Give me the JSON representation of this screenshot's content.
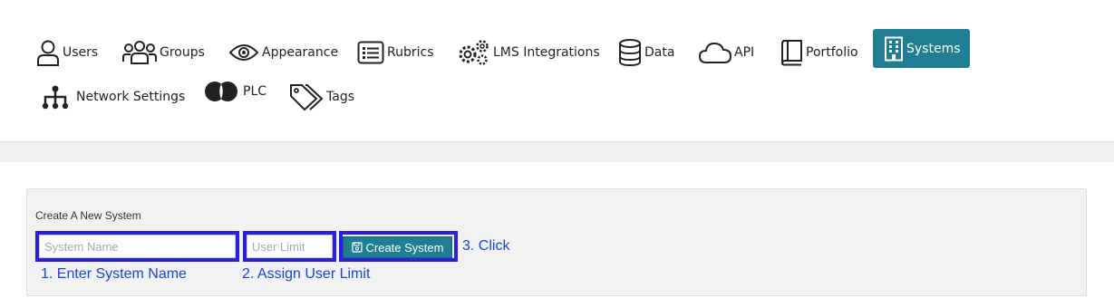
{
  "nav": {
    "items": [
      {
        "label": "Users",
        "icon": "user-icon"
      },
      {
        "label": "Groups",
        "icon": "groups-icon"
      },
      {
        "label": "Appearance",
        "icon": "eye-icon"
      },
      {
        "label": "Rubrics",
        "icon": "list-icon"
      },
      {
        "label": "LMS Integrations",
        "icon": "gears-icon"
      },
      {
        "label": "Data",
        "icon": "database-icon"
      },
      {
        "label": "API",
        "icon": "cloud-icon"
      },
      {
        "label": "Portfolio",
        "icon": "book-icon"
      },
      {
        "label": "Systems",
        "icon": "building-icon",
        "active": true
      },
      {
        "label": "Network Settings",
        "icon": "network-icon"
      },
      {
        "label": "PLC",
        "icon": "plc-icon"
      },
      {
        "label": "Tags",
        "icon": "tags-icon"
      }
    ],
    "active_color": "#1f7e93"
  },
  "form": {
    "title": "Create A New System",
    "system_name_placeholder": "System Name",
    "user_limit_placeholder": "User Limit",
    "create_button_label": "Create System",
    "highlight_color": "#2a1fe0"
  },
  "annotations": {
    "step1": "1. Enter System Name",
    "step2": "2. Assign User Limit",
    "step3": "3. Click"
  }
}
